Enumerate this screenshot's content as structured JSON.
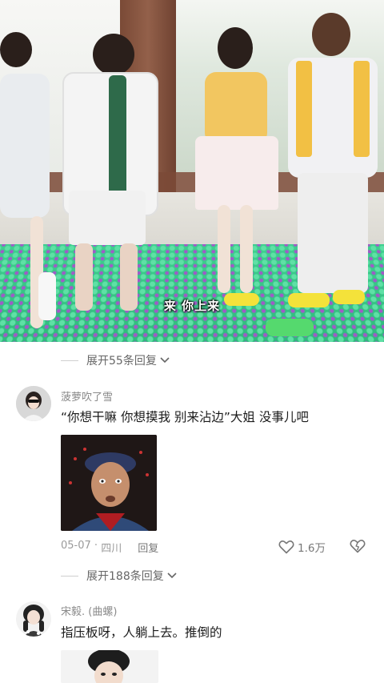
{
  "video": {
    "subtitle": "来 你上来"
  },
  "thread": {
    "expand_top_label": "展开55条回复",
    "comments": [
      {
        "username": "菠萝吹了雪",
        "text": "“你想干嘛 你想摸我 别来沾边”大姐 没事儿吧",
        "date": "05-07",
        "location": "四川",
        "reply_label": "回复",
        "likes": "1.6万"
      },
      {
        "username": "宋毅. (曲螺)",
        "text": "指压板呀，人躺上去。推倒的"
      }
    ],
    "expand_mid_label": "展开188条回复"
  },
  "icons": {
    "expand": "chevron-down-icon",
    "like": "heart-icon",
    "dislike": "broken-heart-icon"
  },
  "colors": {
    "meta_text": "#9a9a9a",
    "body_text": "#1b1b1b",
    "mat_green": "#3fcf8f"
  }
}
